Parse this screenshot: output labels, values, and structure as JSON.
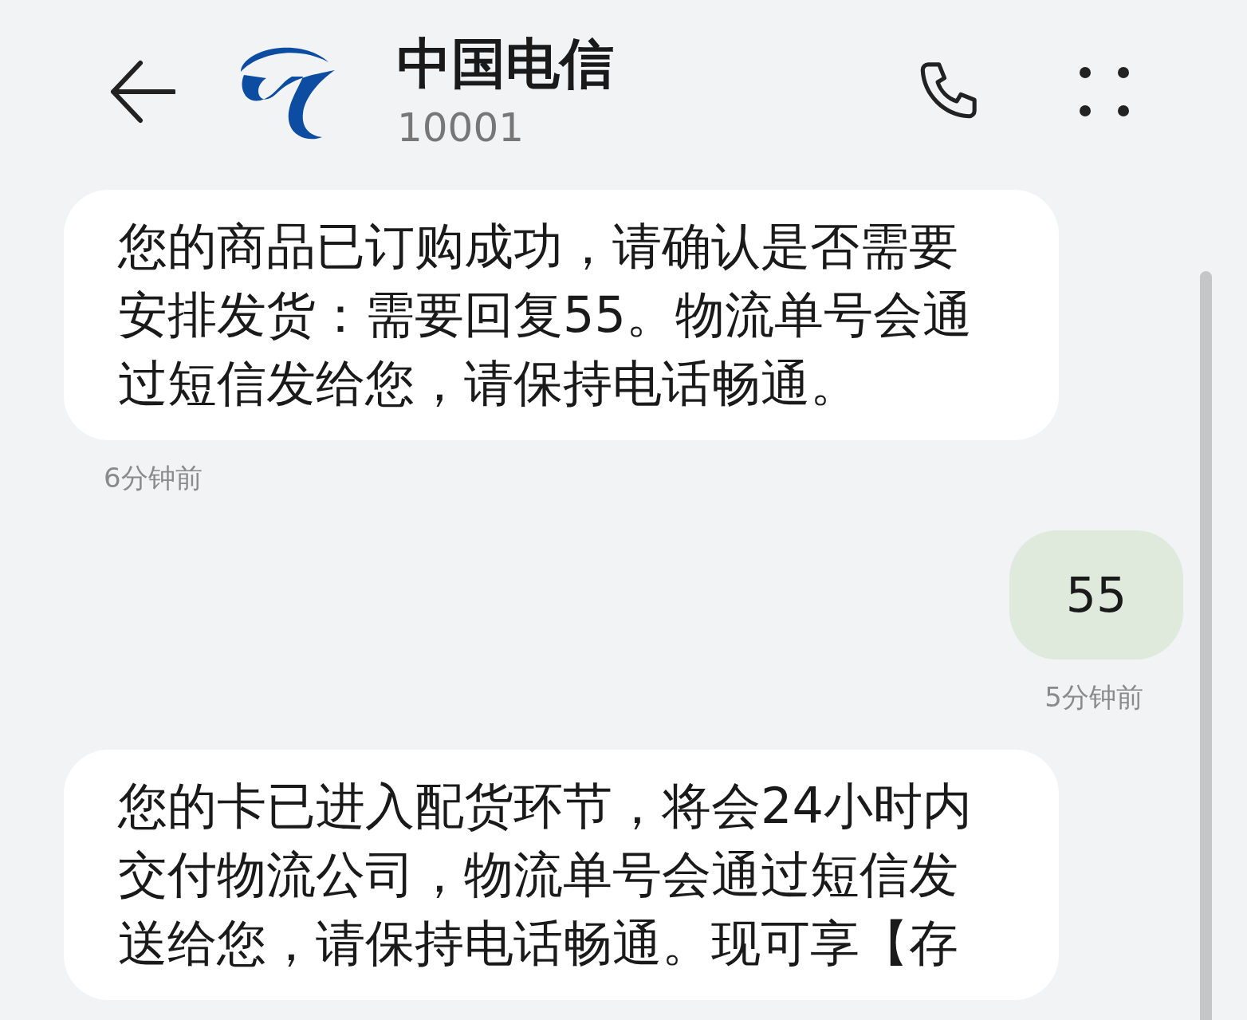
{
  "header": {
    "title": "中国电信",
    "number": "10001"
  },
  "messages": [
    {
      "kind": "received",
      "text": "您的商品已订购成功，请确认是否需要安排发货：需要回复55。物流单号会通过短信发给您，请保持电话畅通。",
      "time": "6分钟前"
    },
    {
      "kind": "sent",
      "text": "55",
      "time": "5分钟前"
    },
    {
      "kind": "received",
      "text": "您的卡已进入配货环节，将会24小时内交付物流公司，物流单号会通过短信发送给您，请保持电话畅通。现可享【存"
    }
  ]
}
